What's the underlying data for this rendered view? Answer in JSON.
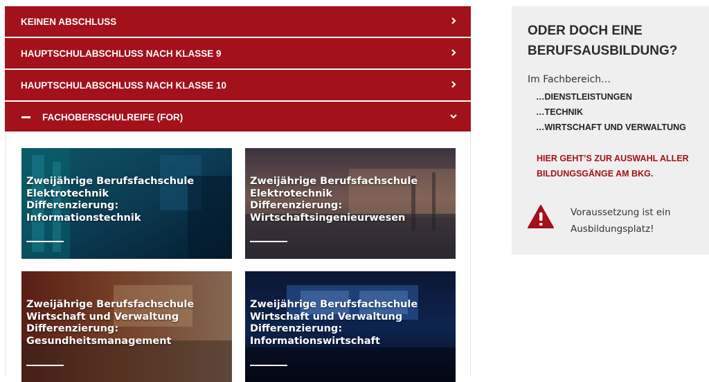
{
  "accordion": [
    {
      "label": "KEINEN ABSCHLUSS",
      "expanded": false
    },
    {
      "label": "HAUPTSCHULABSCHLUSS NACH KLASSE 9",
      "expanded": false
    },
    {
      "label": "HAUPTSCHULABSCHLUSS NACH KLASSE 10",
      "expanded": false
    },
    {
      "label": "FACHOBERSCHULREIFE (FOR)",
      "expanded": true
    }
  ],
  "cards": [
    {
      "line1": "Zweijährige Berufsfachschule",
      "line2": "Elektrotechnik",
      "line3": "Differenzierung:",
      "line4": "Informationstechnik"
    },
    {
      "line1": "Zweijährige Berufsfachschule",
      "line2": "Elektrotechnik",
      "line3": "Differenzierung:",
      "line4": "Wirtschaftsingenieurwesen"
    },
    {
      "line1": "Zweijährige Berufsfachschule",
      "line2": "Wirtschaft und Verwaltung",
      "line3": "Differenzierung:",
      "line4": "Gesundheitsmanagement"
    },
    {
      "line1": "Zweijährige Berufsfachschule",
      "line2": "Wirtschaft und Verwaltung",
      "line3": "Differenzierung:",
      "line4": "Informationswirtschaft"
    }
  ],
  "sidebar": {
    "heading_line1": "ODER DOCH EINE",
    "heading_line2": "BERUFSAUSBILDUNG?",
    "intro": "Im Fachbereich…",
    "categories": [
      "…DIENSTLEISTUNGEN",
      "…TECHNIK",
      "…WIRTSCHAFT UND VERWALTUNG"
    ],
    "link": "HIER GEHT’S ZUR AUSWAHL ALLER BILDUNGSGÄNGE AM BKG.",
    "note_line1": "Voraussetzung ist ein",
    "note_line2": "Ausbildungsplatz!"
  },
  "colors": {
    "accent": "#a3111b",
    "sidebar_bg": "#efefef"
  },
  "icons": {
    "collapsed": "chevron-right-icon",
    "expanded": "chevron-down-icon",
    "open_marker": "minus-icon",
    "notice": "warning-triangle-icon"
  }
}
